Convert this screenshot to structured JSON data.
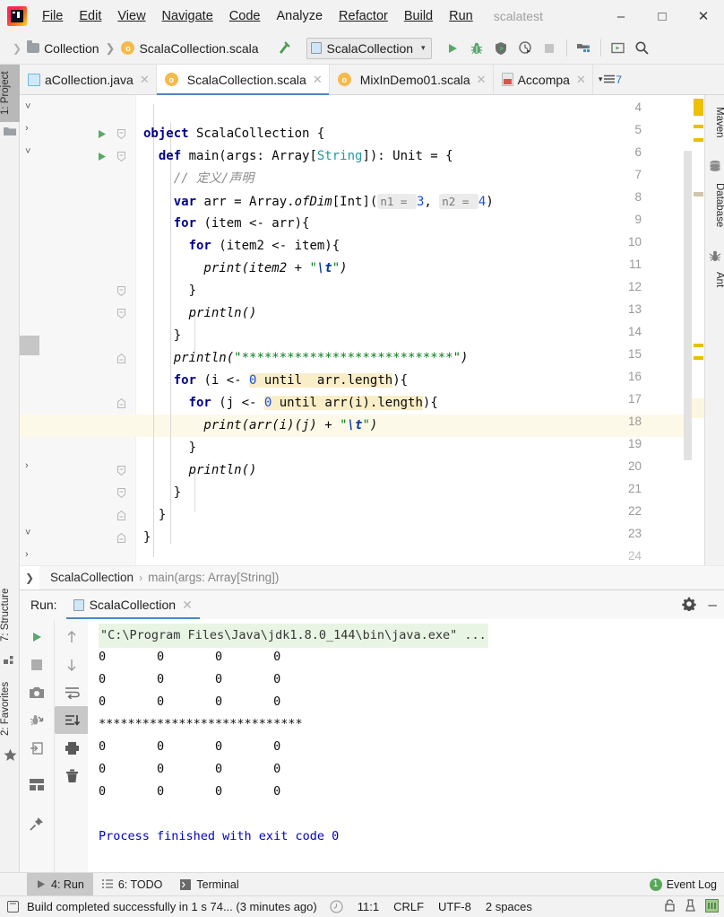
{
  "window": {
    "project_name": "scalatest",
    "minimize": "–",
    "maximize": "□",
    "close": "✕"
  },
  "menubar": {
    "items": [
      {
        "label": "File"
      },
      {
        "label": "Edit"
      },
      {
        "label": "View"
      },
      {
        "label": "Navigate"
      },
      {
        "label": "Code"
      },
      {
        "label": "Analyze"
      },
      {
        "label": "Refactor"
      },
      {
        "label": "Build"
      },
      {
        "label": "Run"
      }
    ]
  },
  "toolbar": {
    "breadcrumb": [
      {
        "label": "Collection",
        "icon": "folder-icon"
      },
      {
        "label": "ScalaCollection.scala",
        "icon": "scala-file-icon"
      }
    ],
    "separator": "❯",
    "make_project_icon": "hammer-icon",
    "run_config": {
      "label": "ScalaCollection",
      "icon": "run-configuration-icon",
      "arrow": "⌄"
    },
    "actions": [
      {
        "name": "run-button",
        "icon": "play-icon"
      },
      {
        "name": "debug-button",
        "icon": "bug-icon"
      },
      {
        "name": "run-with-coverage-button",
        "icon": "coverage-icon"
      },
      {
        "name": "profile-button",
        "icon": "profiler-icon"
      },
      {
        "name": "stop-button",
        "icon": "stop-icon"
      },
      {
        "name": "project-structure-button",
        "icon": "project-structure-icon"
      },
      {
        "name": "updating-app-button",
        "icon": "update-app-icon"
      },
      {
        "name": "search-everywhere-button",
        "icon": "search-icon"
      }
    ]
  },
  "tabs": {
    "items": [
      {
        "label": "aCollection.java",
        "icon": "java-file-icon",
        "active": false
      },
      {
        "label": "ScalaCollection.scala",
        "icon": "scala-object-icon",
        "active": true
      },
      {
        "label": "MixInDemo01.scala",
        "icon": "scala-object-icon",
        "active": false
      },
      {
        "label": "Accompa",
        "icon": "scala-class-icon",
        "active": false
      }
    ],
    "overflow_count": "7",
    "overflow_icon": "chevron-down-list-icon"
  },
  "left_tool_strip": {
    "items": [
      {
        "label": "1: Project",
        "icon": "project-folder-icon",
        "selected": true
      },
      {
        "label": "7: Structure",
        "icon": "structure-icon",
        "selected": false
      },
      {
        "label": "2: Favorites",
        "icon": "star-icon",
        "selected": false
      }
    ]
  },
  "right_tool_strip": {
    "items": [
      {
        "label": "Maven",
        "icon": "maven-icon"
      },
      {
        "label": "Database",
        "icon": "database-icon"
      },
      {
        "label": "Ant",
        "icon": "ant-icon"
      }
    ]
  },
  "editor": {
    "lines": [
      {
        "n": "4",
        "text": "",
        "type": "plain"
      },
      {
        "n": "5",
        "text": "object ScalaCollection {",
        "type": "code",
        "runmark": true,
        "fold": "expanded"
      },
      {
        "n": "6",
        "text": "  def main(args: Array[String]): Unit = {",
        "type": "code",
        "runmark": true,
        "fold": "expanded"
      },
      {
        "n": "7",
        "text": "    // 定义/声明",
        "type": "comment"
      },
      {
        "n": "8",
        "text": "    var arr = Array.ofDim[Int]( n1 = 3, n2 = 4)",
        "type": "code"
      },
      {
        "n": "9",
        "text": "    for (item <- arr){",
        "type": "code",
        "fold": "expanded"
      },
      {
        "n": "10",
        "text": "      for (item2 <- item){",
        "type": "code",
        "fold": "expanded"
      },
      {
        "n": "11",
        "text": "        print(item2 + \"\\t\")",
        "type": "code"
      },
      {
        "n": "12",
        "text": "      }",
        "type": "code",
        "fold": "collapsed-end"
      },
      {
        "n": "13",
        "text": "      println()",
        "type": "code"
      },
      {
        "n": "14",
        "text": "    }",
        "type": "code",
        "fold": "collapsed-end"
      },
      {
        "n": "15",
        "text": "    println(\"****************************\")",
        "type": "code"
      },
      {
        "n": "16",
        "text": "    for (i <- 0 until  arr.length){",
        "type": "code",
        "fold": "expanded"
      },
      {
        "n": "17",
        "text": "      for (j <- 0 until arr(i).length){",
        "type": "code",
        "fold": "expanded"
      },
      {
        "n": "18",
        "text": "        print(arr(i)(j) + \"\\t\")",
        "type": "code",
        "caret": true
      },
      {
        "n": "19",
        "text": "      }",
        "type": "code",
        "fold": "collapsed-end"
      },
      {
        "n": "20",
        "text": "      println()",
        "type": "code"
      },
      {
        "n": "21",
        "text": "    }",
        "type": "code",
        "fold": "collapsed-end"
      },
      {
        "n": "22",
        "text": "  }",
        "type": "code",
        "fold": "collapsed-end"
      },
      {
        "n": "23",
        "text": "}",
        "type": "code",
        "fold": "collapsed-end"
      },
      {
        "n": "24",
        "text": "",
        "type": "plain"
      }
    ],
    "inlay_hints": [
      "n1 = ",
      "n2 = "
    ],
    "colors": {
      "keyword": "#00008c",
      "string": "#067d17",
      "number": "#1750eb",
      "type": "#20999d",
      "comment": "#8c8c8c",
      "search_highlight": "#faeec8",
      "caret_line": "#fdf9e8"
    }
  },
  "breadcrumb_bar": {
    "chevron": "❯",
    "items": [
      "ScalaCollection",
      "main(args: Array[String])"
    ],
    "separator": "›"
  },
  "run_panel": {
    "title": "Run:",
    "tab_label": "ScalaCollection",
    "tab_icon": "run-configuration-icon",
    "close_icon": "✕",
    "settings_icon": "gear-icon",
    "minimize_icon": "–",
    "tools_left": [
      {
        "name": "rerun-button",
        "icon": "play-icon"
      },
      {
        "name": "stop-button",
        "icon": "stop-icon"
      },
      {
        "name": "screenshot-button",
        "icon": "camera-icon"
      },
      {
        "name": "dump-threads-button",
        "icon": "thread-dump-icon"
      },
      {
        "name": "exit-button",
        "icon": "exit-icon"
      },
      {
        "name": "layout-button",
        "icon": "layout-icon"
      },
      {
        "name": "pin-tab-button",
        "icon": "pin-icon"
      }
    ],
    "tools_right": [
      {
        "name": "up-button",
        "icon": "arrow-up-icon"
      },
      {
        "name": "down-button",
        "icon": "arrow-down-icon"
      },
      {
        "name": "soft-wrap-button",
        "icon": "soft-wrap-icon"
      },
      {
        "name": "scroll-to-end-button",
        "icon": "scroll-to-end-icon",
        "selected": true
      },
      {
        "name": "print-button",
        "icon": "printer-icon"
      },
      {
        "name": "clear-all-button",
        "icon": "trash-icon"
      }
    ],
    "console": {
      "command": "\"C:\\Program Files\\Java\\jdk1.8.0_144\\bin\\java.exe\" ...",
      "lines": [
        "0\t0\t0\t0",
        "0\t0\t0\t0",
        "0\t0\t0\t0",
        "****************************",
        "0\t0\t0\t0",
        "0\t0\t0\t0",
        "0\t0\t0\t0",
        ""
      ],
      "exit_message": "Process finished with exit code 0"
    }
  },
  "bottom_strip": {
    "items": [
      {
        "label": "4: Run",
        "icon": "play-icon",
        "selected": true
      },
      {
        "label": "6: TODO",
        "icon": "todo-icon",
        "selected": false
      },
      {
        "label": "Terminal",
        "icon": "terminal-icon",
        "selected": false
      }
    ],
    "event_log": {
      "label": "Event Log",
      "badge": "1"
    }
  },
  "status_bar": {
    "message": "Build completed successfully in 1 s 74... (3 minutes ago)",
    "caret_position": "11:1",
    "line_separator": "CRLF",
    "encoding": "UTF-8",
    "indent": "2 spaces",
    "icons": [
      "memory-icon",
      "clock-icon",
      "lock-icon",
      "inspection-icon",
      "ide-mode-icon"
    ]
  }
}
